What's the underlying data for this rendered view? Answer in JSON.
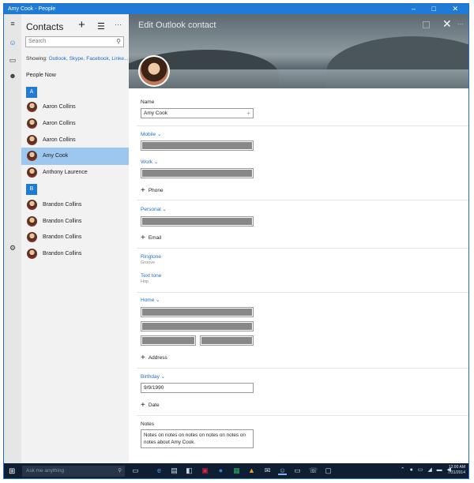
{
  "window": {
    "title": "Amy Cook - People",
    "controls": "– □ ✕"
  },
  "rail": {
    "icons": [
      "menu-icon",
      "people-icon",
      "chat-icon",
      "contacts-icon",
      "settings-icon"
    ]
  },
  "list_pane": {
    "title": "Contacts",
    "add_glyph": "+",
    "select_glyph": "☰",
    "more_glyph": "···",
    "search_placeholder": "Search",
    "showing_prefix": "Showing:",
    "showing_sources": "Outlook, Skype, Facebook, Linke...",
    "people_now": "People Now",
    "groups": [
      {
        "letter": "A",
        "contacts": [
          "Aaron Collins",
          "Aaron Collins",
          "Aaron Collins",
          "Amy Cook",
          "Anthony Laurence"
        ]
      },
      {
        "letter": "B",
        "contacts": [
          "Brandon Collins",
          "Brandon Collins",
          "Brandon Collins",
          "Brandon Collins"
        ]
      }
    ],
    "selected_contact": "Amy Cook"
  },
  "editor": {
    "header_title": "Edit Outlook contact",
    "close_glyph": "✕",
    "more_glyph": "···",
    "name_label": "Name",
    "name_value": "Amy Cook",
    "mobile_label": "Mobile ⌄",
    "work_label": "Work ⌄",
    "add_phone": "Phone",
    "personal_label": "Personal ⌄",
    "add_email": "Email",
    "ringtone_label": "Ringtone",
    "ringtone_value": "Groove",
    "texttone_label": "Text tone",
    "texttone_value": "Hop",
    "home_label": "Home ⌄",
    "add_address": "Address",
    "birthday_label": "Birthday ⌄",
    "birthday_value": "9/9/1990",
    "add_date": "Date",
    "notes_label": "Notes",
    "notes_value": "Notes on notes on notes on notes on notes on notes about Amy Cook.",
    "plus_glyph": "+"
  },
  "taskbar": {
    "search_placeholder": "Ask me anything",
    "clock_time": "12:00 AM",
    "clock_date": "7/31/2014"
  }
}
